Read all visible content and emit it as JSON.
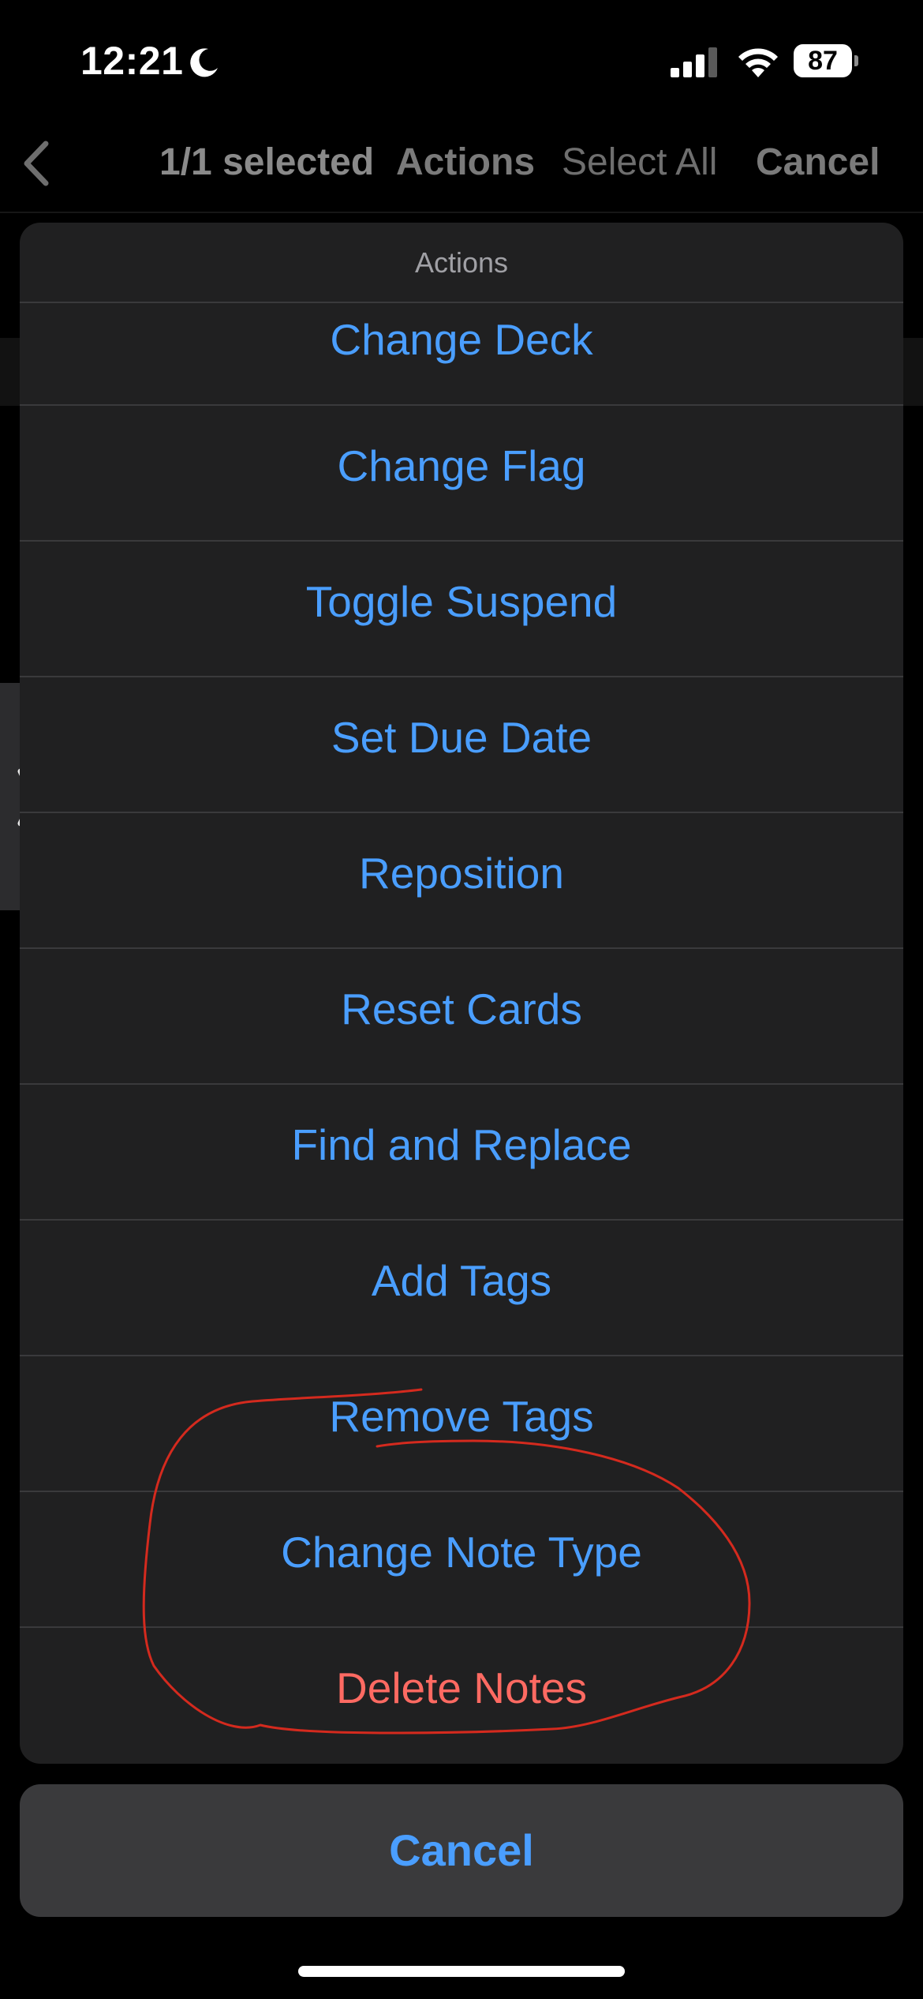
{
  "status_bar": {
    "time": "12:21",
    "battery": "87",
    "icons": [
      "moon-icon",
      "signal-icon",
      "wifi-icon",
      "battery-icon"
    ]
  },
  "nav": {
    "back_icon": "chevron-left-icon",
    "selected": "1/1 selected",
    "actions": "Actions",
    "select_all": "Select All",
    "cancel": "Cancel"
  },
  "sheet": {
    "title": "Actions",
    "items": [
      {
        "label": "Change Deck"
      },
      {
        "label": "Change Flag"
      },
      {
        "label": "Toggle Suspend"
      },
      {
        "label": "Set Due Date"
      },
      {
        "label": "Reposition"
      },
      {
        "label": "Reset Cards"
      },
      {
        "label": "Find and Replace"
      },
      {
        "label": "Add Tags"
      },
      {
        "label": "Remove Tags"
      },
      {
        "label": "Change Note Type"
      },
      {
        "label": "Delete Notes"
      }
    ],
    "cancel": "Cancel"
  },
  "colors": {
    "action_blue": "#4a9eff",
    "destructive_red": "#ff6a62",
    "annotation_red": "#d42a1e",
    "sheet_bg": "#202021"
  }
}
